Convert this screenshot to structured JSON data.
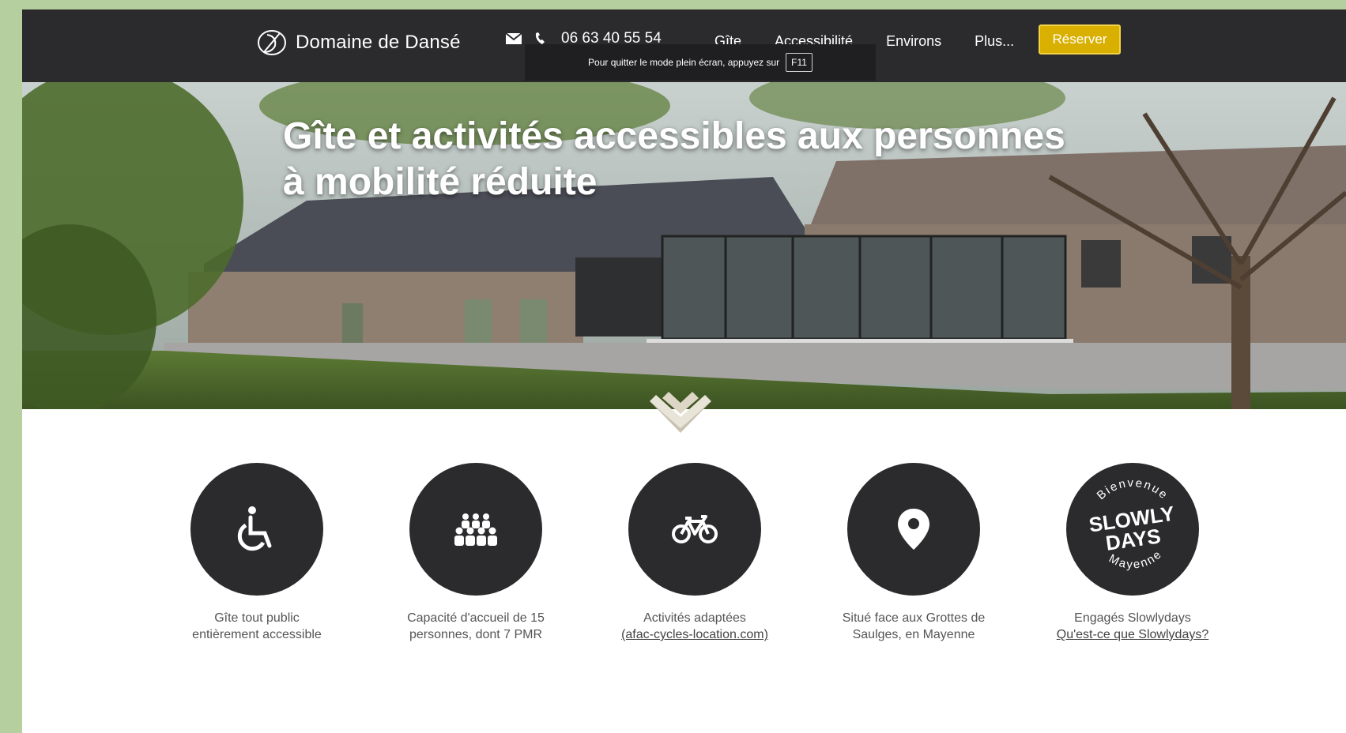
{
  "navbar": {
    "brand": "Domaine de Dansé",
    "phone": "06 63 40 55 54",
    "links": [
      "Gîte",
      "Accessibilité",
      "Environs",
      "Plus..."
    ],
    "cta": "Réserver",
    "fullscreen_notice": "Pour quitter le mode plein écran, appuyez sur",
    "fullscreen_key": "F11"
  },
  "hero": {
    "title_line1": "Gîte et activités accessibles aux personnes",
    "title_line2": "à mobilité réduite"
  },
  "features": [
    {
      "icon": "wheelchair-icon",
      "line1": "Gîte tout public",
      "line2": "entièrement accessible"
    },
    {
      "icon": "group-icon",
      "line1": "Capacité d'accueil de 15",
      "line2": "personnes, dont 7 PMR"
    },
    {
      "icon": "bicycle-icon",
      "line1": "Activités adaptées",
      "link": "(afac-cycles-location.com)"
    },
    {
      "icon": "location-pin-icon",
      "line1": "Situé face aux Grottes de",
      "line2": "Saulges, en Mayenne"
    },
    {
      "icon": "slowlydays-logo",
      "line1": "Engagés Slowlydays",
      "link": "Qu'est-ce que Slowlydays?",
      "logo_top": "Bienvenue",
      "logo_main1": "SLOWLY",
      "logo_main2": "DAYS",
      "logo_bottom": "Mayenne"
    }
  ],
  "colors": {
    "dark": "#2b2a2c",
    "accent": "#d9b000",
    "page_bg": "#b5cf9f"
  }
}
